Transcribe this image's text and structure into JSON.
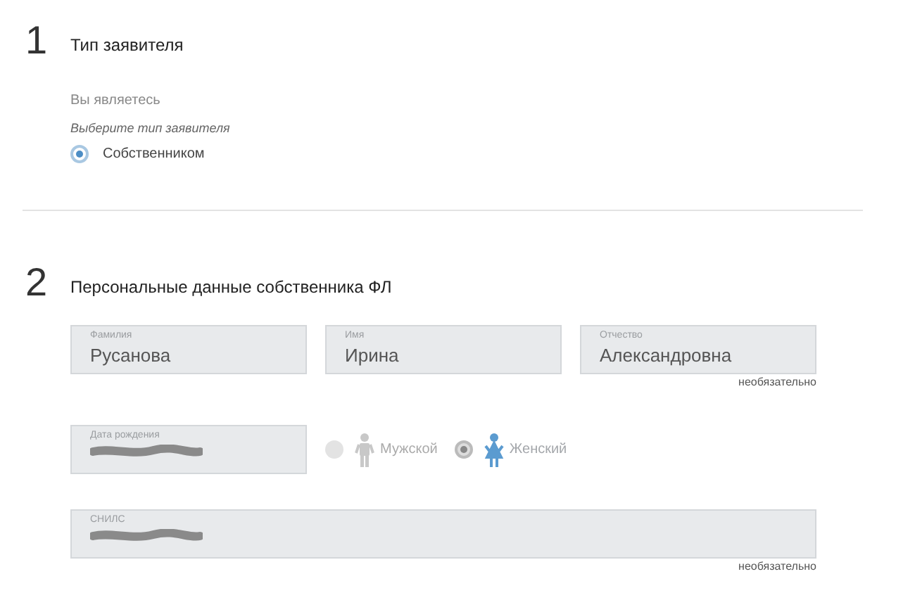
{
  "sections": [
    {
      "number": "1",
      "title": "Тип заявителя",
      "question": "Вы являетесь",
      "hint": "Выберите тип заявителя",
      "options": [
        {
          "label": "Собственником",
          "selected": true
        }
      ]
    },
    {
      "number": "2",
      "title": "Персональные данные собственника ФЛ",
      "rows": [
        {
          "kind": "fields",
          "fields": [
            {
              "label": "Фамилия",
              "value": "Русанова"
            },
            {
              "label": "Имя",
              "value": "Ирина"
            },
            {
              "label": "Отчество",
              "value": "Александровна",
              "note": "необязательно"
            }
          ]
        },
        {
          "kind": "birth",
          "field": {
            "label": "Дата рождения",
            "redacted": true
          },
          "genders": [
            {
              "kind": "male",
              "label": "Мужской",
              "selected": false
            },
            {
              "kind": "female",
              "label": "Женский",
              "selected": true
            }
          ]
        },
        {
          "kind": "wide",
          "field": {
            "label": "СНИЛС",
            "redacted": true,
            "note": "необязательно"
          }
        }
      ]
    }
  ]
}
